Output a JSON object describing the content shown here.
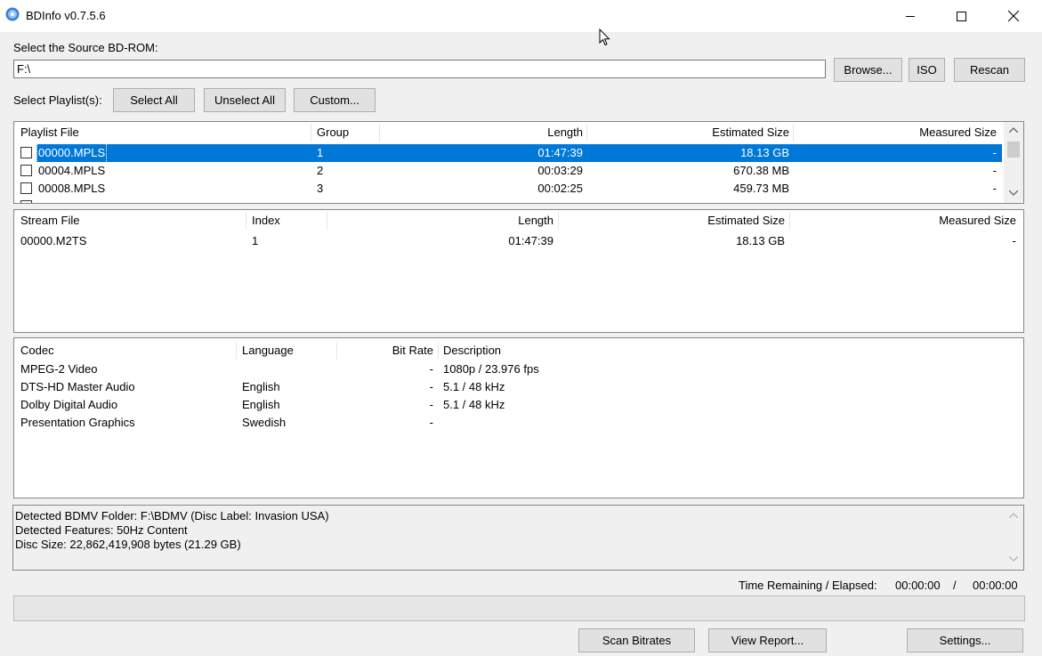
{
  "window": {
    "title": "BDInfo v0.7.5.6"
  },
  "source": {
    "label": "Select the Source BD-ROM:",
    "path": "F:\\",
    "browse": "Browse...",
    "iso": "ISO",
    "rescan": "Rescan"
  },
  "playlists": {
    "label": "Select Playlist(s):",
    "select_all": "Select All",
    "unselect_all": "Unselect All",
    "custom": "Custom...",
    "headers": [
      "Playlist File",
      "Group",
      "Length",
      "Estimated Size",
      "Measured Size"
    ],
    "rows": [
      {
        "file": "00000.MPLS",
        "group": "1",
        "length": "01:47:39",
        "est": "18.13 GB",
        "meas": "-",
        "selected": true
      },
      {
        "file": "00004.MPLS",
        "group": "2",
        "length": "00:03:29",
        "est": "670.38 MB",
        "meas": "-",
        "selected": false
      },
      {
        "file": "00008.MPLS",
        "group": "3",
        "length": "00:02:25",
        "est": "459.73 MB",
        "meas": "-",
        "selected": false
      }
    ]
  },
  "streams": {
    "headers": [
      "Stream File",
      "Index",
      "Length",
      "Estimated Size",
      "Measured Size"
    ],
    "rows": [
      {
        "file": "00000.M2TS",
        "index": "1",
        "length": "01:47:39",
        "est": "18.13 GB",
        "meas": "-"
      }
    ]
  },
  "codecs": {
    "headers": [
      "Codec",
      "Language",
      "Bit Rate",
      "Description"
    ],
    "rows": [
      {
        "codec": "MPEG-2 Video",
        "language": "",
        "bitrate": "-",
        "desc": "1080p / 23.976 fps"
      },
      {
        "codec": "DTS-HD Master Audio",
        "language": "English",
        "bitrate": "-",
        "desc": "5.1 / 48 kHz"
      },
      {
        "codec": "Dolby Digital Audio",
        "language": "English",
        "bitrate": "-",
        "desc": "5.1 / 48 kHz"
      },
      {
        "codec": "Presentation Graphics",
        "language": "Swedish",
        "bitrate": "-",
        "desc": ""
      }
    ]
  },
  "info": {
    "lines": [
      "Detected BDMV Folder: F:\\BDMV (Disc Label: Invasion USA)",
      "Detected Features: 50Hz Content",
      "Disc Size: 22,862,419,908 bytes (21.29 GB)"
    ]
  },
  "status": {
    "label": "Time Remaining / Elapsed:",
    "remaining": "00:00:00",
    "separator": "/",
    "elapsed": "00:00:00",
    "progress": 0
  },
  "footer": {
    "scan": "Scan Bitrates",
    "report": "View Report...",
    "settings": "Settings..."
  },
  "colors": {
    "selection": "#0078d7",
    "panel_border": "#828790"
  },
  "icons": [
    "bdinfo-disc-icon",
    "minimize-icon",
    "maximize-icon",
    "close-icon",
    "checkbox-icon",
    "scroll-up-icon",
    "scroll-down-icon",
    "mouse-cursor-icon"
  ]
}
